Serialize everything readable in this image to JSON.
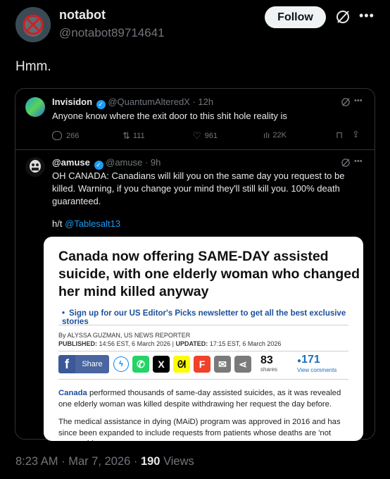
{
  "post": {
    "display_name": "notabot",
    "handle": "@notabot89714641",
    "follow_label": "Follow",
    "text": "Hmm."
  },
  "quoted": {
    "display_name": "Invisidon",
    "handle": "@QuantumAlteredX",
    "time": "· 12h",
    "text": "Anyone know where the exit door to this shit hole reality is",
    "stats": {
      "replies": "266",
      "reposts": "111",
      "likes": "961",
      "views": "22K"
    }
  },
  "nested": {
    "display_name": "@amuse",
    "handle": "@amuse",
    "time": "· 9h",
    "text": "OH CANADA: Canadians will kill you on the same day you request to be killed. Warning, if you change your mind they'll still kill you. 100% death guaranteed.",
    "ht_prefix": "h/t",
    "ht_handle": "@Tablesalt13"
  },
  "article": {
    "headline": "Canada now offering SAME-DAY assisted suicide, with one elderly woman who changed her mind killed anyway",
    "signup": "Sign up for our US Editor's Picks newsletter to get all the best exclusive stories",
    "byline": "By ALYSSA GUZMAN, US NEWS REPORTER",
    "published_label": "PUBLISHED:",
    "published": "14:56 EST, 6 March 2026",
    "updated_label": "UPDATED:",
    "updated": "17:15 EST, 6 March 2026",
    "share_label": "Share",
    "shares_count": "83",
    "shares_label": "shares",
    "comments_count": "171",
    "comments_label": "View comments",
    "para1_link": "Canada",
    "para1": " performed thousands of same-day assisted suicides, as it was revealed one elderly woman was killed despite withdrawing her request the day before.",
    "para2": "The medical assistance in dying (MAiD) program was approved in 2016 and has since been expanded to include requests from patients whose deaths are 'not reasonably"
  },
  "footer": {
    "time": "8:23 AM · Mar 7, 2026 ·",
    "views_count": "190",
    "views_label": "Views"
  },
  "colors": {
    "accent": "#1d9bf0",
    "background": "#000000",
    "muted": "#71767b"
  }
}
